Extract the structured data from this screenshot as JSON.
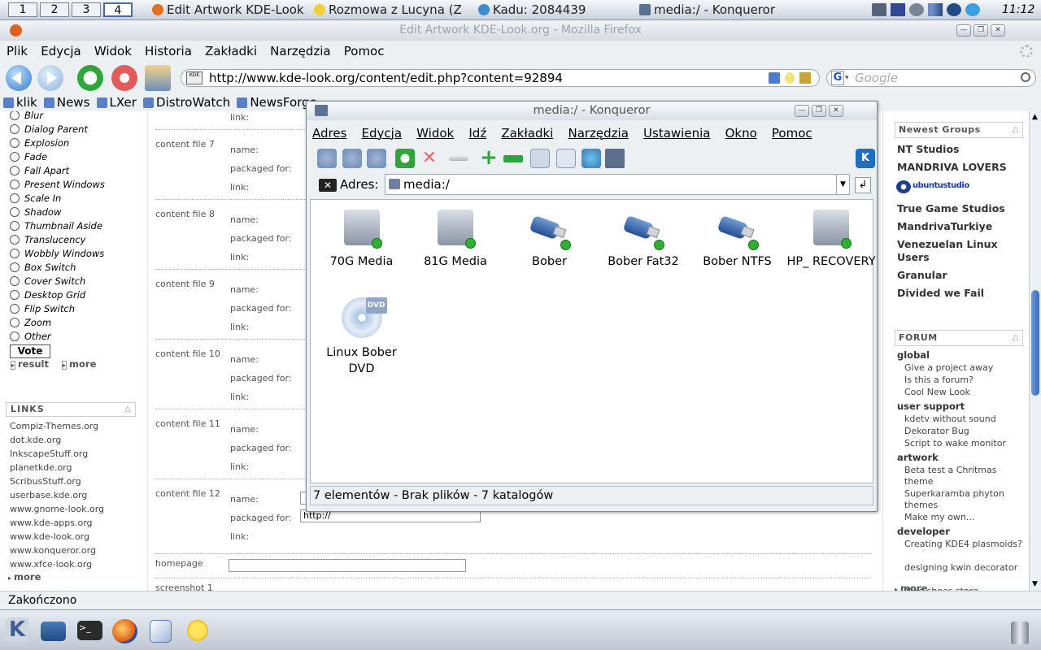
{
  "topbar": {
    "desktops": [
      "1",
      "2",
      "3",
      "4"
    ],
    "active_desktop": "4",
    "tasks": [
      {
        "label": "Edit Artwork KDE-Look"
      },
      {
        "label": "Rozmowa z Lucyna (Z"
      },
      {
        "label": "Kadu: 2084439"
      },
      {
        "label": "media:/ - Konqueror"
      }
    ],
    "clock": "11:12"
  },
  "firefox": {
    "title": "Edit Artwork KDE-Look.org - Mozilla Firefox",
    "menu": [
      "Plik",
      "Edycja",
      "Widok",
      "Historia",
      "Zakładki",
      "Narzędzia",
      "Pomoc"
    ],
    "url": "http://www.kde-look.org/content/edit.php?content=92894",
    "search_placeholder": "Google",
    "search_engine_label": "G",
    "bookmarks": [
      "klik",
      "News",
      "LXer",
      "DistroWatch",
      "NewsForge"
    ],
    "status": "Zakończono"
  },
  "left": {
    "effects": [
      "Blur",
      "Dialog Parent",
      "Explosion",
      "Fade",
      "Fall Apart",
      "Present Windows",
      "Scale In",
      "Shadow",
      "Thumbnail Aside",
      "Translucency",
      "Wobbly Windows",
      "Box Switch",
      "Cover Switch",
      "Desktop Grid",
      "Flip Switch",
      "Zoom",
      "Other"
    ],
    "vote": "Vote",
    "result": "result",
    "more": "more",
    "links_title": "LINKS",
    "links": [
      "Compiz-Themes.org",
      "dot.kde.org",
      "InkscapeStuff.org",
      "planetkde.org",
      "ScribusStuff.org",
      "userbase.kde.org",
      "www.gnome-look.org",
      "www.kde-apps.org",
      "www.kde-look.org",
      "www.konqueror.org",
      "www.xfce-look.org"
    ],
    "links_more": "more"
  },
  "center": {
    "top_link_label": "link:",
    "content_files": [
      {
        "title": "content file 7"
      },
      {
        "title": "content file 8"
      },
      {
        "title": "content file 9"
      },
      {
        "title": "content file 10"
      },
      {
        "title": "content file 11"
      },
      {
        "title": "content file 12"
      }
    ],
    "labels": {
      "name": "name:",
      "packaged": "packaged for:",
      "link": "link:"
    },
    "link_value": "http://",
    "homepage": "homepage",
    "screenshot": "screenshot 1"
  },
  "right": {
    "groups_title": "Newest Groups",
    "groups": [
      "NT Studios",
      "MANDRIVA LOVERS",
      "True Game Studios",
      "MandrivaTurkiye",
      "Venezuelan Linux Users",
      "Granular",
      "Divided we Fail"
    ],
    "ubuntustudio_logo": "ubuntustudio",
    "forum_title": "FORUM",
    "forum": [
      {
        "cat": "global",
        "items": [
          "Give a project away",
          "Is this a forum?",
          "Cool New Look"
        ]
      },
      {
        "cat": "user support",
        "items": [
          "kdetv without sound",
          "Dekorator Bug",
          "Script to wake monitor"
        ]
      },
      {
        "cat": "artwork",
        "items": [
          "Beta test a Chritmas theme",
          "Superkaramba phyton themes",
          "Make my own..."
        ]
      },
      {
        "cat": "developer",
        "items": [
          "Creating KDE4 plasmoids?",
          "designing kwin decorator",
          "Nike shoes store"
        ]
      }
    ],
    "more": "more"
  },
  "konqueror": {
    "title": "media:/ - Konqueror",
    "menu": [
      "Adres",
      "Edycja",
      "Widok",
      "Idź",
      "Zakładki",
      "Narzędzia",
      "Ustawienia",
      "Okno",
      "Pomoc"
    ],
    "address_label": "Adres:",
    "address": "media:/",
    "items": [
      {
        "label": "70G Media",
        "icon": "hdd-icon"
      },
      {
        "label": "81G Media",
        "icon": "hdd-icon"
      },
      {
        "label": "Bober",
        "icon": "usb-icon"
      },
      {
        "label": "Bober Fat32",
        "icon": "usb-icon"
      },
      {
        "label": "Bober NTFS",
        "icon": "usb-icon"
      },
      {
        "label": "HP_ RECOVERY",
        "icon": "hdd-icon"
      },
      {
        "label": "Linux Bober DVD",
        "icon": "dvd-icon"
      }
    ],
    "dvd_badge": "DVD",
    "status": "7 elementów - Brak plików - 7 katalogów"
  }
}
